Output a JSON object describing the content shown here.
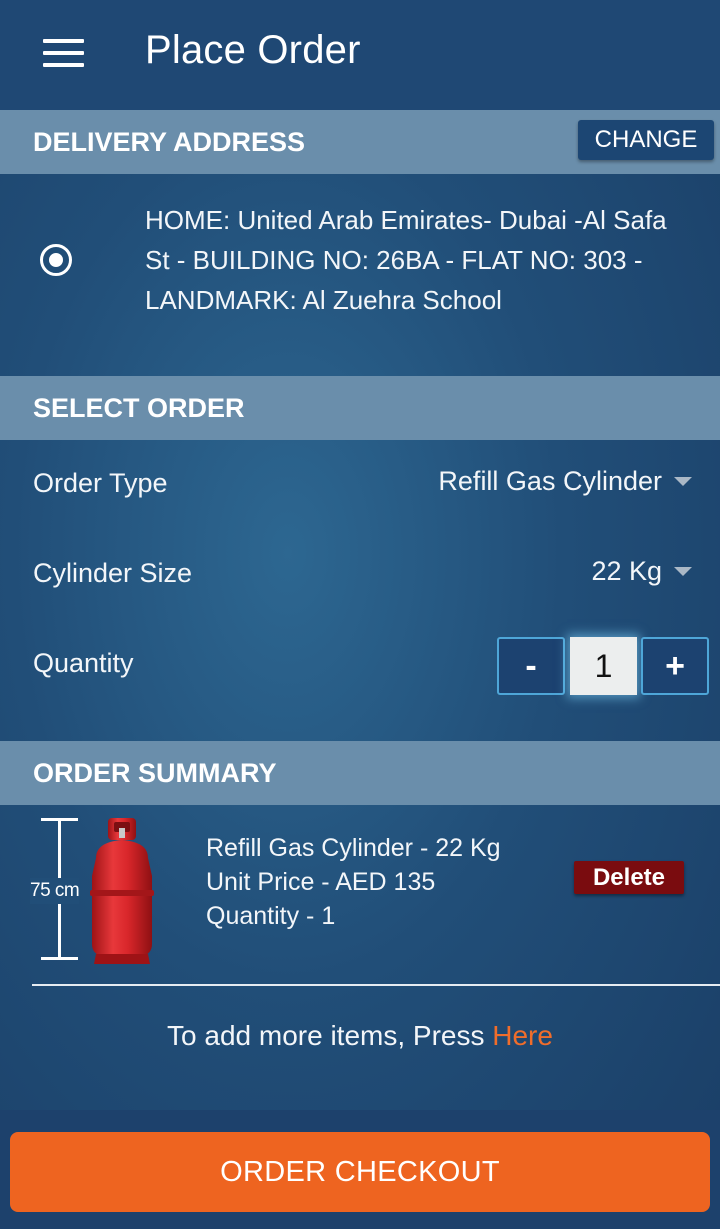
{
  "app_bar": {
    "title": "Place Order"
  },
  "delivery": {
    "header": "DELIVERY ADDRESS",
    "change_label": "CHANGE",
    "address": "HOME:  United Arab Emirates- Dubai -Al Safa St - BUILDING NO: 26BA - FLAT NO: 303 - LANDMARK: Al Zuehra School",
    "selected": true
  },
  "select_order": {
    "header": "SELECT ORDER",
    "order_type_label": "Order Type",
    "order_type_value": "Refill Gas Cylinder",
    "cylinder_size_label": "Cylinder Size",
    "cylinder_size_value": "22 Kg",
    "quantity_label": "Quantity",
    "minus_label": "-",
    "quantity_value": "1",
    "plus_label": "+"
  },
  "summary": {
    "header": "ORDER SUMMARY",
    "dimension_label": "75 cm",
    "item": {
      "name": "Refill Gas Cylinder - 22 Kg",
      "unit_price": "Unit Price - AED 135",
      "quantity": "Quantity - 1"
    },
    "delete_label": "Delete",
    "add_more_prefix": "To add more items, Press ",
    "add_more_link": "Here"
  },
  "checkout_label": "ORDER CHECKOUT",
  "colors": {
    "accent_orange": "#ee6420",
    "header_band": "#6a8eab",
    "delete_red": "#7a0c0f",
    "cylinder_red": "#d8262a"
  }
}
